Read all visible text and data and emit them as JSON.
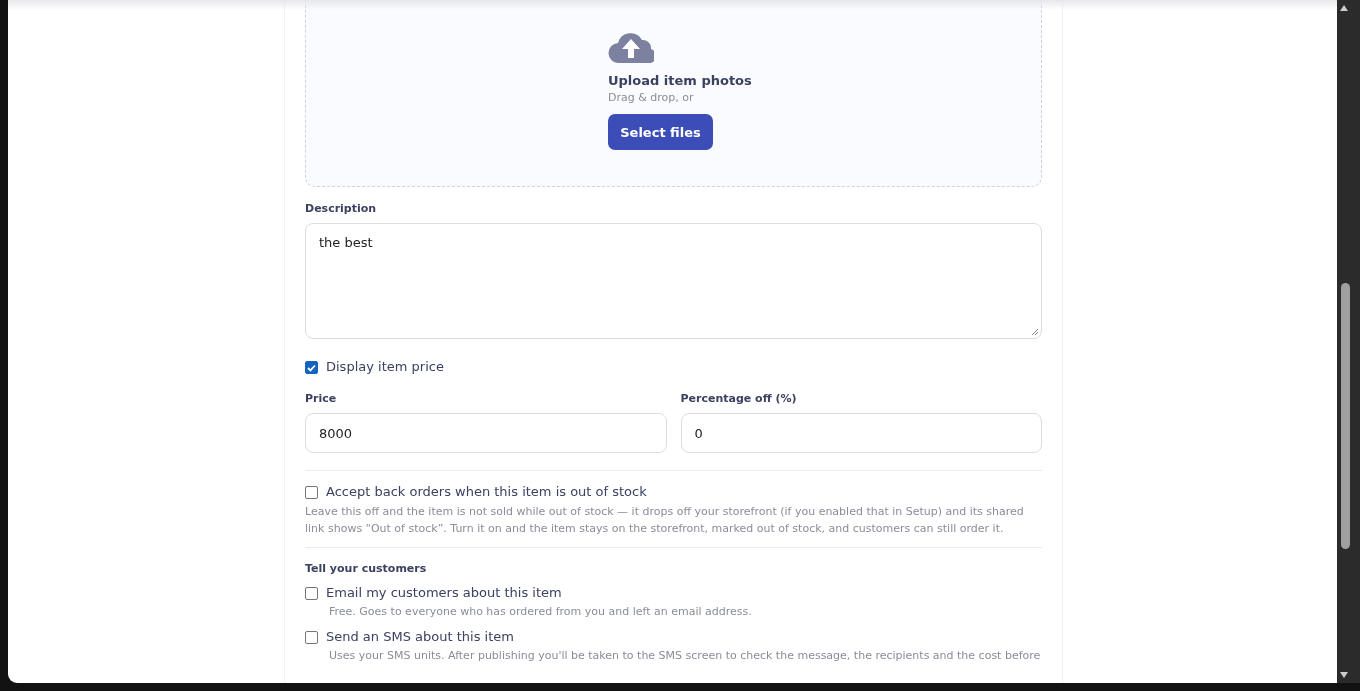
{
  "upload": {
    "title": "Upload item photos",
    "subtitle": "Drag & drop, or",
    "button": "Select files"
  },
  "description": {
    "label": "Description",
    "value": "the best"
  },
  "display_price": {
    "label": "Display item price",
    "checked": true
  },
  "price": {
    "label": "Price",
    "value": "8000"
  },
  "percentage_off": {
    "label": "Percentage off (%)",
    "value": "0"
  },
  "back_orders": {
    "label": "Accept back orders when this item is out of stock",
    "checked": false,
    "help": "Leave this off and the item is not sold while out of stock — it drops off your storefront (if you enabled that in Setup) and its shared link shows “Out of stock”. Turn it on and the item stays on the storefront, marked out of stock, and customers can still order it."
  },
  "notify": {
    "heading": "Tell your customers",
    "options": [
      {
        "label": "Email my customers about this item",
        "checked": false,
        "help": "Free. Goes to everyone who has ordered from you and left an email address."
      },
      {
        "label": "Send an SMS about this item",
        "checked": false,
        "help": "Uses your SMS units. After publishing you'll be taken to the SMS screen to check the message, the recipients and the cost before"
      }
    ]
  }
}
